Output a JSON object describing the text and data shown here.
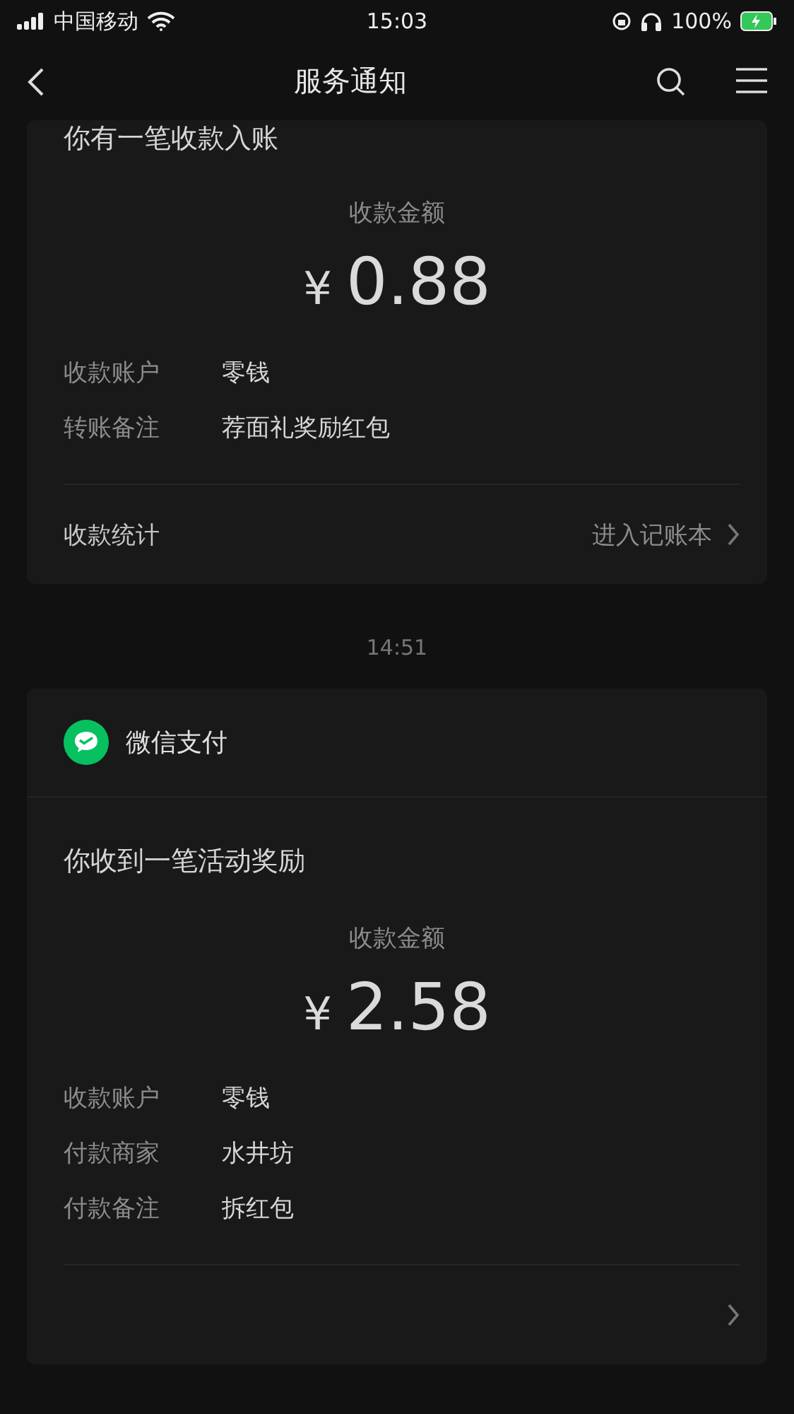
{
  "status_bar": {
    "carrier": "中国移动",
    "time": "15:03",
    "battery": "100%"
  },
  "nav": {
    "title": "服务通知"
  },
  "cards": [
    {
      "title": "你有一笔收款入账",
      "amount_label": "收款金额",
      "currency": "¥",
      "amount": "0.88",
      "rows": [
        {
          "label": "收款账户",
          "value": "零钱"
        },
        {
          "label": "转账备注",
          "value": "荐面礼奖励红包"
        }
      ],
      "footer": {
        "label": "收款统计",
        "action": "进入记账本"
      }
    },
    {
      "time": "14:51",
      "app": "微信支付",
      "title": "你收到一笔活动奖励",
      "amount_label": "收款金额",
      "currency": "¥",
      "amount": "2.58",
      "rows": [
        {
          "label": "收款账户",
          "value": "零钱"
        },
        {
          "label": "付款商家",
          "value": "水井坊"
        },
        {
          "label": "付款备注",
          "value": "拆红包"
        }
      ]
    }
  ]
}
